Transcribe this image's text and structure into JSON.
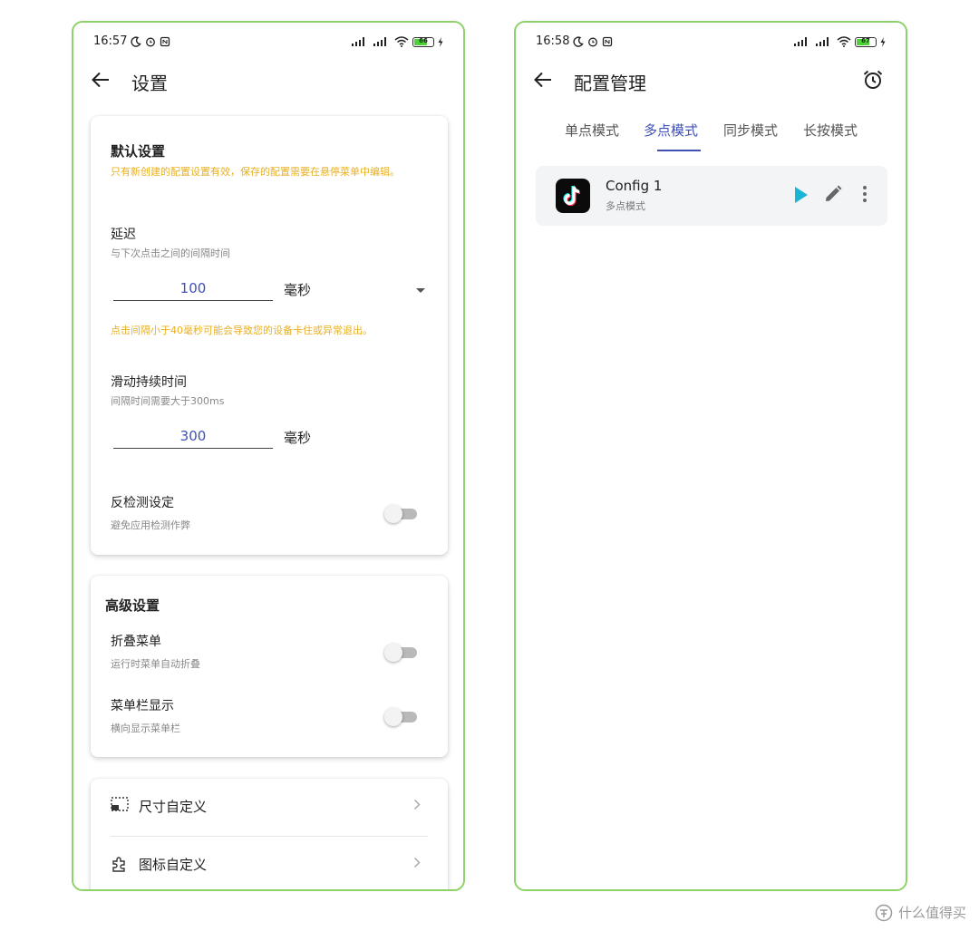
{
  "left": {
    "status": {
      "time": "16:57",
      "battery": "66"
    },
    "title": "设置",
    "default_section": {
      "title": "默认设置",
      "note": "只有新创建的配置设置有效，保存的配置需要在悬停菜单中编辑。",
      "delay": {
        "title": "延迟",
        "subtitle": "与下次点击之间的间隔时间",
        "value": "100",
        "unit": "毫秒"
      },
      "delay_warning": "点击间隔小于40毫秒可能会导致您的设备卡住或异常退出。",
      "swipe": {
        "title": "滑动持续时间",
        "subtitle": "间隔时间需要大于300ms",
        "value": "300",
        "unit": "毫秒"
      },
      "anti_detect": {
        "title": "反检测设定",
        "subtitle": "避免应用检测作弊",
        "enabled": false
      }
    },
    "advanced_section": {
      "title": "高级设置",
      "fold_menu": {
        "title": "折叠菜单",
        "subtitle": "运行时菜单自动折叠",
        "enabled": false
      },
      "menubar": {
        "title": "菜单栏显示",
        "subtitle": "横向显示菜单栏",
        "enabled": false
      }
    },
    "custom_section": {
      "size": {
        "label": "尺寸自定义",
        "icon": "resize-icon"
      },
      "icon": {
        "label": "图标自定义",
        "icon": "puzzle-icon"
      }
    }
  },
  "right": {
    "status": {
      "time": "16:58",
      "battery": "67"
    },
    "title": "配置管理",
    "tabs": [
      {
        "label": "单点模式",
        "active": false
      },
      {
        "label": "多点模式",
        "active": true
      },
      {
        "label": "同步模式",
        "active": false
      },
      {
        "label": "长按模式",
        "active": false
      }
    ],
    "configs": [
      {
        "name": "Config 1",
        "mode": "多点模式",
        "icon": "tiktok-icon"
      }
    ]
  },
  "colors": {
    "accent": "#3f51b5",
    "warning": "#e8b023",
    "frame": "#8fd16a",
    "play": "#19b5d4"
  },
  "watermark": "什么值得买"
}
